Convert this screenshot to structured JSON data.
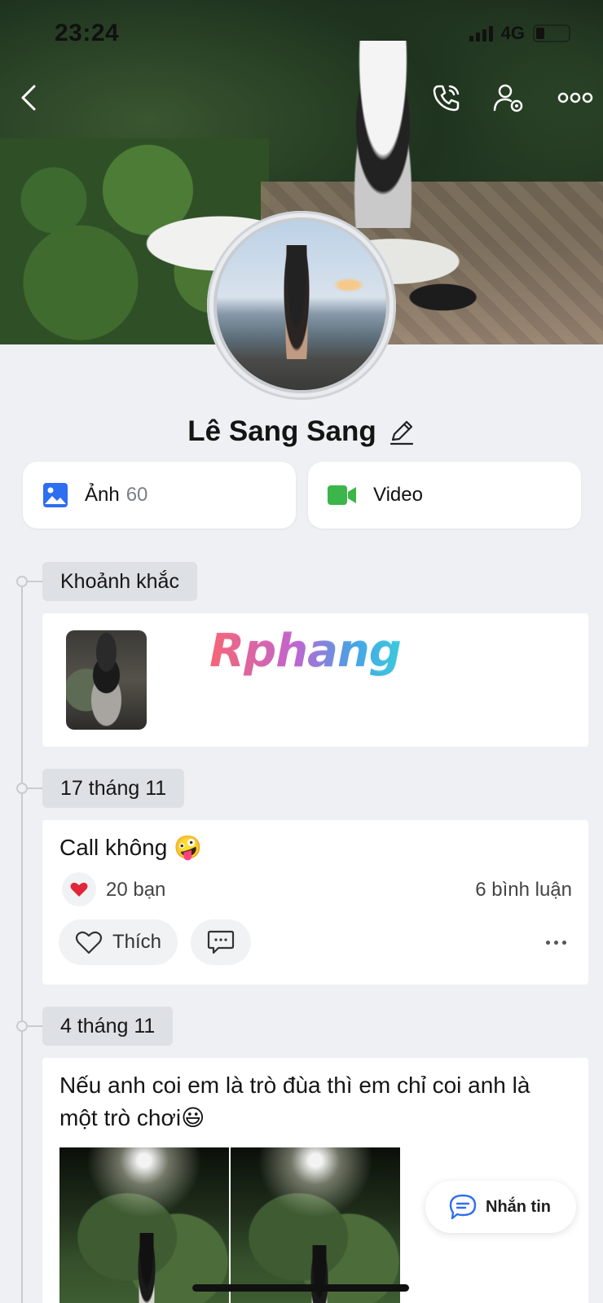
{
  "status_bar": {
    "time": "23:24",
    "network": "4G"
  },
  "top_bar": {
    "back_icon": "chevron-left-icon",
    "call_icon": "phone-call-icon",
    "settings_icon": "user-settings-icon",
    "more_icon": "more-horizontal-icon"
  },
  "profile": {
    "name": "Lê Sang Sang",
    "edit_icon": "pencil-icon"
  },
  "media": {
    "photos_label": "Ảnh",
    "photos_count": "60",
    "video_label": "Video",
    "photos_icon_color": "#2e6ef0",
    "video_icon_color": "#3cb54a"
  },
  "timeline": {
    "moments": {
      "label": "Khoảnh khắc",
      "watermark": "Rphang"
    },
    "posts": [
      {
        "date": "17 tháng 11",
        "text": "Call không 🤪",
        "reaction_icon": "heart-icon",
        "reaction_count": "20 bạn",
        "comments": "6 bình luận",
        "like_label": "Thích"
      },
      {
        "date": "4 tháng 11",
        "text_line1": "Nếu anh coi em là trò đùa thì em chỉ coi anh là",
        "text_line2": "một trò chơi😃"
      }
    ]
  },
  "chat_fab": {
    "label": "Nhắn tin",
    "accent": "#2e6ef0"
  }
}
